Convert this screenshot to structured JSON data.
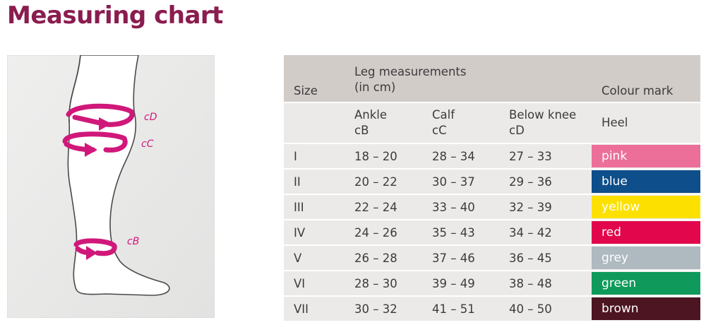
{
  "page": {
    "title": "Measuring chart"
  },
  "illustration": {
    "labels": {
      "cD": "cD",
      "cC": "cC",
      "cB": "cB"
    },
    "colors": {
      "background": "#efefee",
      "leg_outline": "#4a4a4a",
      "arrow": "#d0187a"
    }
  },
  "table": {
    "header": {
      "size": "Size",
      "leg_measurements_line1": "Leg measurements",
      "leg_measurements_line2": "(in cm)",
      "colour_mark": "Colour mark"
    },
    "subheader": {
      "ankle_line1": "Ankle",
      "ankle_line2": "cB",
      "calf_line1": "Calf",
      "calf_line2": "cC",
      "below_knee_line1": "Below knee",
      "below_knee_line2": "cD",
      "heel": "Heel"
    },
    "rows": [
      {
        "size": "I",
        "ankle": "18 – 20",
        "calf": "28 – 34",
        "below_knee": "27 – 33",
        "colour": "pink",
        "colour_hex": "#ec6f99",
        "text_hex": "#ffffff"
      },
      {
        "size": "II",
        "ankle": "20 – 22",
        "calf": "30 – 37",
        "below_knee": "29 – 36",
        "colour": "blue",
        "colour_hex": "#0e4e8a",
        "text_hex": "#ffffff"
      },
      {
        "size": "III",
        "ankle": "22 – 24",
        "calf": "33 – 40",
        "below_knee": "32 – 39",
        "colour": "yellow",
        "colour_hex": "#fce100",
        "text_hex": "#ffffff"
      },
      {
        "size": "IV",
        "ankle": "24 – 26",
        "calf": "35 – 43",
        "below_knee": "34 – 42",
        "colour": "red",
        "colour_hex": "#e2064d",
        "text_hex": "#ffffff"
      },
      {
        "size": "V",
        "ankle": "26 – 28",
        "calf": "37 – 46",
        "below_knee": "36 – 45",
        "colour": "grey",
        "colour_hex": "#aeb9c0",
        "text_hex": "#ffffff"
      },
      {
        "size": "VI",
        "ankle": "28 – 30",
        "calf": "39 – 49",
        "below_knee": "38 – 48",
        "colour": "green",
        "colour_hex": "#0f9a5b",
        "text_hex": "#ffffff"
      },
      {
        "size": "VII",
        "ankle": "30 – 32",
        "calf": "41 – 51",
        "below_knee": "40 – 50",
        "colour": "brown",
        "colour_hex": "#4c1521",
        "text_hex": "#ffffff"
      }
    ]
  }
}
